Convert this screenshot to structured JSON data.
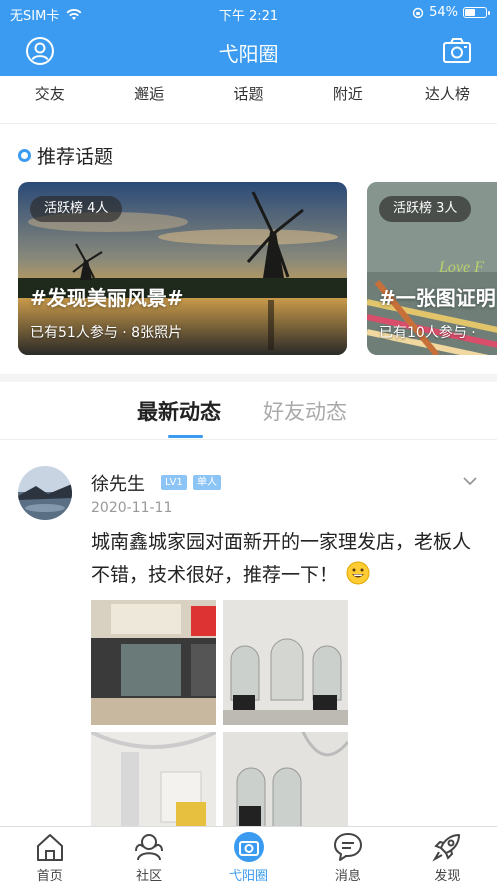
{
  "status_bar": {
    "carrier": "无SIM卡",
    "time": "下午 2:21",
    "battery": "54%",
    "battery_level": 0.54
  },
  "header": {
    "title": "弋阳圈",
    "left_icon": "user-avatar-icon",
    "right_icon": "camera-icon"
  },
  "categories": [
    "交友",
    "邂逅",
    "话题",
    "附近",
    "达人榜"
  ],
  "recommended": {
    "title": "推荐话题",
    "cards": [
      {
        "rank": "活跃榜 4人",
        "topic": "#发现美丽风景#",
        "meta": "已有51人参与 · 8张照片"
      },
      {
        "rank": "活跃榜 3人",
        "topic": "#一张图证明",
        "meta": "已有10人参与 ·"
      }
    ]
  },
  "feed_tabs": {
    "latest": "最新动态",
    "friends": "好友动态"
  },
  "post": {
    "username": "徐先生",
    "level_badge": "LV1",
    "tag_badge": "单人",
    "date": "2020-11-11",
    "text": "城南鑫城家园对面新开的一家理发店，老板人不错，技术很好，推荐一下！",
    "emoji": "grinning-face-icon",
    "photo_count": 4
  },
  "bottom_nav": [
    {
      "label": "首页",
      "icon": "home-icon"
    },
    {
      "label": "社区",
      "icon": "community-icon"
    },
    {
      "label": "弋阳圈",
      "icon": "circle-camera-icon",
      "active": true
    },
    {
      "label": "消息",
      "icon": "message-icon"
    },
    {
      "label": "发现",
      "icon": "rocket-icon"
    }
  ],
  "colors": {
    "accent": "#3a9bf0",
    "text": "#222222",
    "muted": "#999999"
  }
}
